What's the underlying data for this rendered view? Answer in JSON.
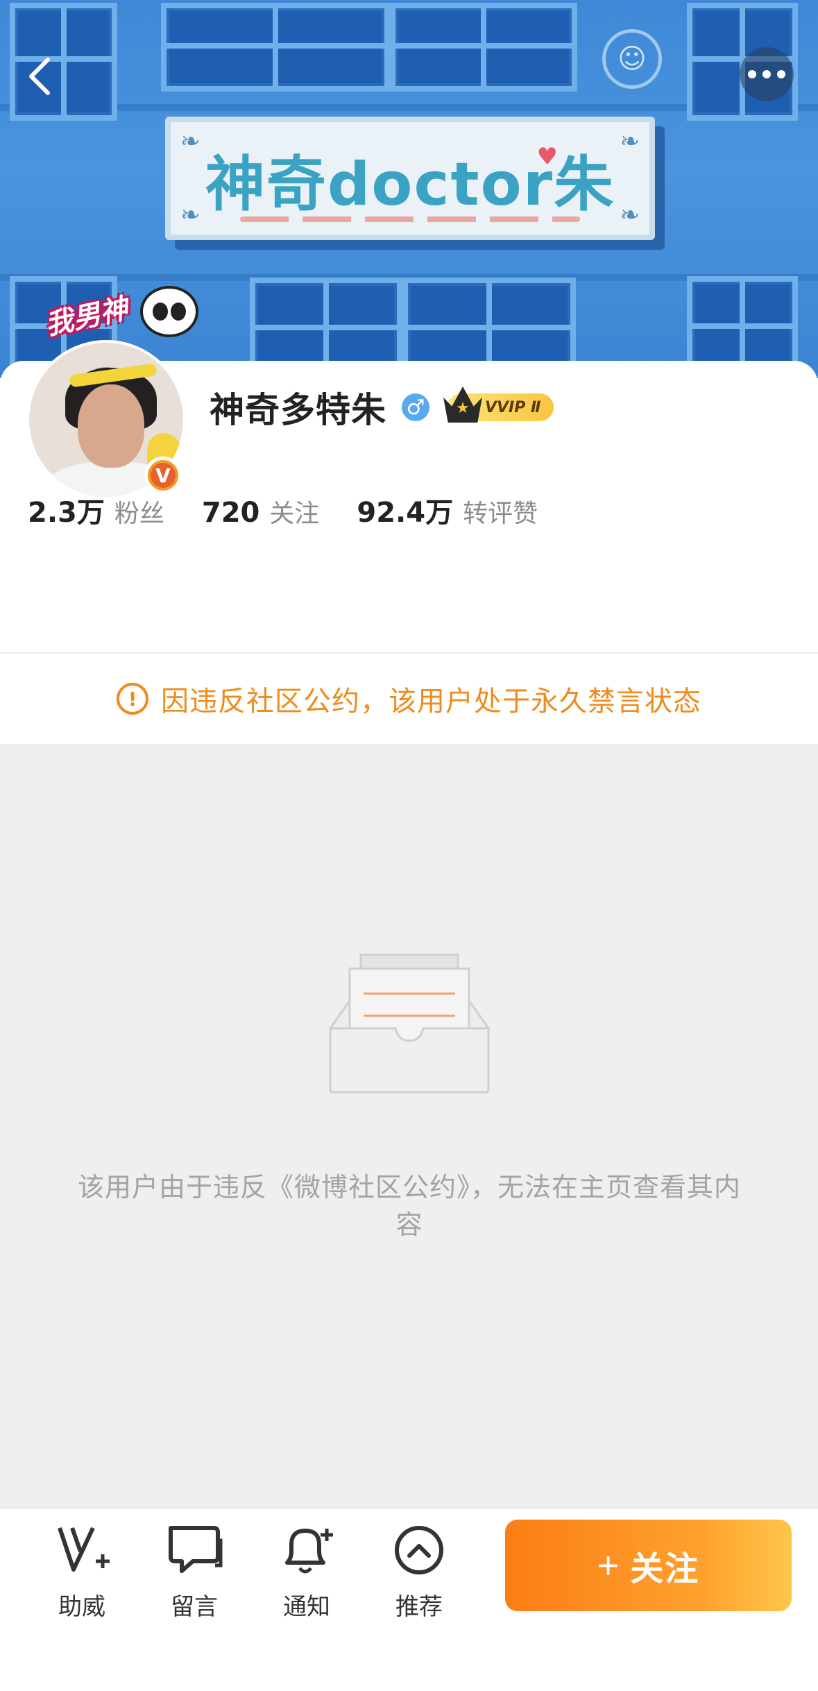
{
  "banner": {
    "sign_text": "神奇doctor朱"
  },
  "nav": {
    "back_icon": "chevron-left-icon",
    "more_icon": "more-horizontal-icon"
  },
  "profile": {
    "sticker_text": "我男神",
    "name": "神奇多特朱",
    "gender_symbol": "♂",
    "vip_label": "VVIP Ⅱ",
    "verified_mark": "V"
  },
  "stats": [
    {
      "value": "2.3万",
      "label": "粉丝"
    },
    {
      "value": "720",
      "label": "关注"
    },
    {
      "value": "92.4万",
      "label": "转评赞"
    }
  ],
  "notice": {
    "icon": "!",
    "text": "因违反社区公约，该用户处于永久禁言状态"
  },
  "empty_state": {
    "message": "该用户由于违反《微博社区公约》，无法在主页查看其内容"
  },
  "bottom_bar": {
    "tabs": [
      {
        "label": "助威",
        "icon": "cheer-v-icon"
      },
      {
        "label": "留言",
        "icon": "message-icon"
      },
      {
        "label": "通知",
        "icon": "bell-plus-icon"
      },
      {
        "label": "推荐",
        "icon": "chevron-up-circle-icon"
      }
    ],
    "follow_plus": "+",
    "follow_label": "关注"
  },
  "colors": {
    "accent_orange": "#f08b1a",
    "follow_gradient_start": "#fb7d14",
    "follow_gradient_end": "#ffc64a",
    "banner_blue": "#4a94de"
  }
}
